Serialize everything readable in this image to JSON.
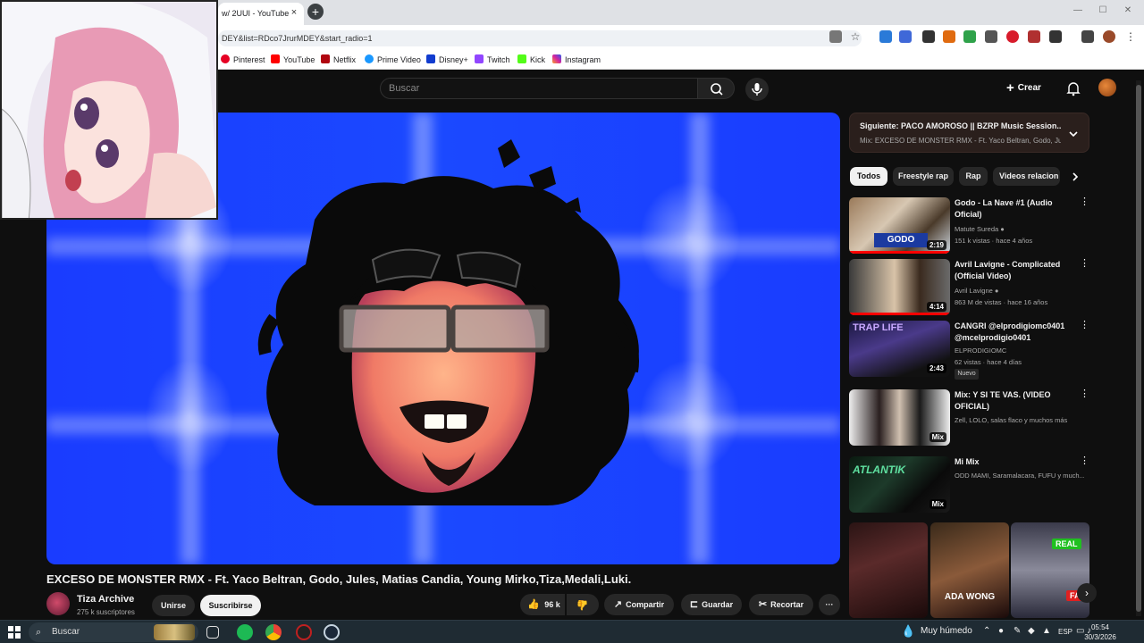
{
  "browser": {
    "tab_title": "w/ 2UUI - YouTube",
    "tab_close": "×",
    "new_tab": "+",
    "address": "DEY&list=RDco7JrurMDEY&start_radio=1",
    "bookmarks": [
      "Pinterest",
      "YouTube",
      "Netflix",
      "Prime Video",
      "Disney+",
      "Twitch",
      "Kick",
      "Instagram"
    ],
    "window_controls": [
      "—",
      "☐",
      "✕"
    ]
  },
  "header": {
    "search_placeholder": "Buscar",
    "create_label": "Crear",
    "create_icon": "+"
  },
  "video": {
    "title": "EXCESO DE MONSTER RMX - Ft. Yaco Beltran, Godo, Jules, Matias Candia, Young Mirko,Tiza,Medali,Luki.",
    "channel": "Tiza Archive",
    "subscribers": "275 k suscriptores",
    "join_label": "Unirse",
    "subscribe_label": "Suscribirse",
    "likes": "96 k",
    "share_label": "Compartir",
    "save_label": "Guardar",
    "clip_label": "Recortar",
    "more": "···"
  },
  "sidebar": {
    "next_title": "Siguiente: PACO AMOROSO || BZRP Music Session...",
    "next_sub": "Mix: EXCESO DE MONSTER RMX - Ft. Yaco Beltran, Godo, Ju...",
    "chips": [
      "Todos",
      "Freestyle rap",
      "Rap",
      "Videos relacion"
    ],
    "items": [
      {
        "title": "Godo - La Nave #1 (Audio Oficial)",
        "channel": "Matute Sureda",
        "stats": "151 k vistas · hace 4 años",
        "duration": "2:19"
      },
      {
        "title": "Avril Lavigne - Complicated (Official Video)",
        "channel": "Avril Lavigne",
        "stats": "863 M de vistas · hace 16 años",
        "duration": "4:14"
      },
      {
        "title": "CANGRI @elprodigiomc0401 @mcelprodigio0401",
        "channel": "ELPRODIGIOMC",
        "stats": "62 vistas · hace 4 días",
        "badge": "Nuevo",
        "duration": "2:43"
      },
      {
        "title": "Mix: Y SI TE VAS. (VIDEO OFICIAL)",
        "channel": "Zell, LOLO, salas flaco y muchos más",
        "duration": "Mix"
      },
      {
        "title": "Mi Mix",
        "channel": "ODD MAMI, Saramalacara, FUFU y much...",
        "duration": "Mix"
      }
    ],
    "shorts": [
      "ADA WONG",
      "REAL",
      "FAKE"
    ]
  },
  "taskbar": {
    "search_label": "Buscar",
    "weather": "Muy húmedo",
    "language": "ESP",
    "time": "05:54",
    "date": "30/3/2026"
  },
  "colors": {
    "bg": "#0f0f0f",
    "video_blue": "#1b49ff",
    "accent_red": "#ff0000"
  }
}
